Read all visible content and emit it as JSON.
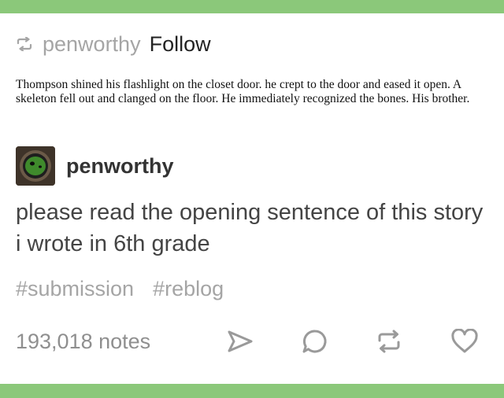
{
  "header": {
    "reblog_icon": "reblog-icon",
    "username": "penworthy",
    "follow_label": "Follow"
  },
  "quote": {
    "text": "Thompson shined his flashlight on the closet door. he crept to the door and eased it open. A skeleton fell out and clanged on the floor. He immediately recognized the bones. His brother."
  },
  "author": {
    "avatar_icon": "avatar",
    "name": "penworthy"
  },
  "post": {
    "body": "please read the opening sentence of this story i wrote in 6th grade"
  },
  "tags": [
    "#submission",
    "#reblog"
  ],
  "footer": {
    "notes": "193,018 notes",
    "icons": [
      "share-icon",
      "reply-icon",
      "reblog-icon",
      "like-icon"
    ]
  },
  "colors": {
    "accent_bar": "#8bc87a",
    "faint_text": "#a5a5a5",
    "icon_gray": "#9a9a9a"
  }
}
